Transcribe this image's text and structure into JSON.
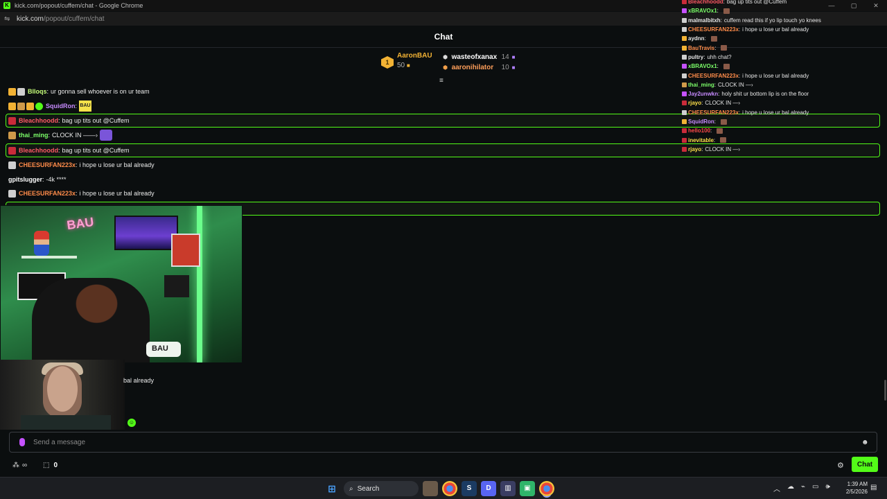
{
  "browser": {
    "window_title": "kick.com/popout/cuffem/chat - Google Chrome",
    "address_host": "kick.com",
    "address_path": "/popout/cuffem/chat",
    "favicon_letter": "K"
  },
  "chat": {
    "header_title": "Chat",
    "leaderboard": {
      "rank": "1",
      "top_name": "AaronBAU",
      "top_points": "50",
      "rows": [
        {
          "name": "wasteofxanax",
          "value": "14"
        },
        {
          "name": "aaronihilator",
          "value": "10"
        }
      ]
    },
    "messages": [
      {
        "user": "Blloqs",
        "text": "ur gonna sell whoever is on ur team",
        "color": "#c7ff7a"
      },
      {
        "user": "SquidRon",
        "text": "",
        "color": "#c78bff"
      },
      {
        "user": "Bleachhoodd",
        "text": "bag up tits out @Cuffem",
        "color": "#ff5a66"
      },
      {
        "user": "thai_ming",
        "text": "CLOCK IN ——›",
        "color": "#7dff6a"
      },
      {
        "user": "Bleachhoodd",
        "text": "bag up tits out @Cuffem",
        "color": "#ff5a66"
      },
      {
        "user": "CHEESURFAN223x",
        "text": "i hope u lose ur bal already",
        "color": "#ff8c4a"
      },
      {
        "user": "gpitslugger",
        "text": "-4k ****",
        "color": "#9ad0ff"
      },
      {
        "user": "CHEESURFAN223x",
        "text": "i hope u lose ur bal already",
        "color": "#ff8c4a"
      }
    ],
    "partial_text": "bal already",
    "input_placeholder": "Send a message",
    "points_value": "0",
    "chat_button_label": "Chat"
  },
  "overlay_chat": [
    {
      "user": "Bleachhoodd",
      "text": "bag up tits out @Cuffem",
      "color": "#ff5a66"
    },
    {
      "user": "xBRAVOx1",
      "text": "",
      "color": "#7dff6a"
    },
    {
      "user": "malmalbitxh",
      "text": "cuffem read this if yo lip touch yo knees",
      "color": "#e6e6e6"
    },
    {
      "user": "CHEESURFAN223x",
      "text": "i hope u lose ur bal already",
      "color": "#ff8c4a"
    },
    {
      "user": "aydnn",
      "text": "",
      "color": "#e6e6e6"
    },
    {
      "user": "BauTravis",
      "text": "",
      "color": "#ff8c4a"
    },
    {
      "user": "pultry",
      "text": "uhh chat?",
      "color": "#e6e6e6"
    },
    {
      "user": "xBRAVOx1",
      "text": "",
      "color": "#7dff6a"
    },
    {
      "user": "CHEESURFAN223x",
      "text": "i hope u lose ur bal already",
      "color": "#ff8c4a"
    },
    {
      "user": "thai_ming",
      "text": "CLOCK IN —›",
      "color": "#7dff6a"
    },
    {
      "user": "Jay2unwkn",
      "text": "holy shit ur bottom lip is on the floor",
      "color": "#c78bff"
    },
    {
      "user": "rjayo",
      "text": "CLOCK IN —›",
      "color": "#ffe14a"
    },
    {
      "user": "CHEESURFAN223x",
      "text": "i hope u lose ur bal already",
      "color": "#ff8c4a"
    },
    {
      "user": "SquidRon",
      "text": "",
      "color": "#c78bff"
    },
    {
      "user": "hello100",
      "text": "",
      "color": "#ff4a4a"
    },
    {
      "user": "inevitable",
      "text": "",
      "color": "#ffe14a"
    },
    {
      "user": "rjayo",
      "text": "CLOCK IN —›",
      "color": "#ffe14a"
    }
  ],
  "video": {
    "neon_sign": "BAU",
    "pillow_text": "BAU"
  },
  "taskbar": {
    "search_label": "Search",
    "time": "1:39 AM",
    "date": "2/5/2026"
  },
  "colors": {
    "kick_green": "#53fc18",
    "background": "#0b0e0f"
  }
}
